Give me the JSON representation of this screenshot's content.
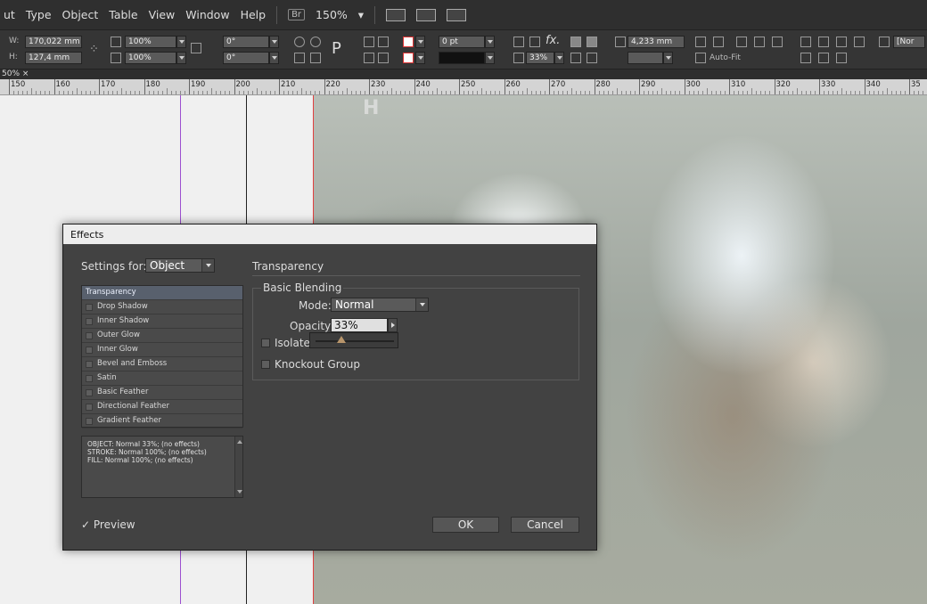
{
  "menubar": {
    "items": [
      "ut",
      "Type",
      "Object",
      "Table",
      "View",
      "Window",
      "Help"
    ],
    "bridge_label": "Br",
    "zoom": "150%"
  },
  "control": {
    "w_label": "W:",
    "w_value": "170,022 mm",
    "h_label": "H:",
    "h_value": "127,4 mm",
    "scale_x": "100%",
    "scale_y": "100%",
    "rotate": "0°",
    "shear": "0°",
    "stroke_weight": "0 pt",
    "opacity": "33%",
    "offset": "4,233 mm",
    "autofit": "Auto-Fit",
    "style_label": "[Nor"
  },
  "document_tab": {
    "label": "50%",
    "close": "×"
  },
  "ruler": {
    "labels": [
      "150",
      "160",
      "170",
      "180",
      "190",
      "200",
      "210",
      "220",
      "230",
      "240",
      "250",
      "260",
      "270",
      "280",
      "290",
      "300",
      "310",
      "320",
      "330",
      "340",
      "35"
    ]
  },
  "dialog": {
    "title": "Effects",
    "settings_for_label": "Settings for:",
    "settings_for_value": "Object",
    "section_title": "Transparency",
    "effects": [
      {
        "label": "Transparency",
        "selected": true,
        "checkbox": false
      },
      {
        "label": "Drop Shadow",
        "selected": false,
        "checkbox": true
      },
      {
        "label": "Inner Shadow",
        "selected": false,
        "checkbox": true
      },
      {
        "label": "Outer Glow",
        "selected": false,
        "checkbox": true
      },
      {
        "label": "Inner Glow",
        "selected": false,
        "checkbox": true
      },
      {
        "label": "Bevel and Emboss",
        "selected": false,
        "checkbox": true
      },
      {
        "label": "Satin",
        "selected": false,
        "checkbox": true
      },
      {
        "label": "Basic Feather",
        "selected": false,
        "checkbox": true
      },
      {
        "label": "Directional Feather",
        "selected": false,
        "checkbox": true
      },
      {
        "label": "Gradient Feather",
        "selected": false,
        "checkbox": true
      }
    ],
    "summary": [
      "OBJECT: Normal 33%; (no effects)",
      "STROKE: Normal 100%; (no effects)",
      "FILL: Normal 100%; (no effects)"
    ],
    "basic_blending_label": "Basic Blending",
    "mode_label": "Mode:",
    "mode_value": "Normal",
    "opacity_label": "Opacity:",
    "opacity_value": "33%",
    "opacity_slider_fraction": 0.33,
    "isolate_label": "Isolate L",
    "knockout_label": "Knockout Group",
    "preview_check": "✓",
    "preview_label": "Preview",
    "ok_label": "OK",
    "cancel_label": "Cancel"
  }
}
